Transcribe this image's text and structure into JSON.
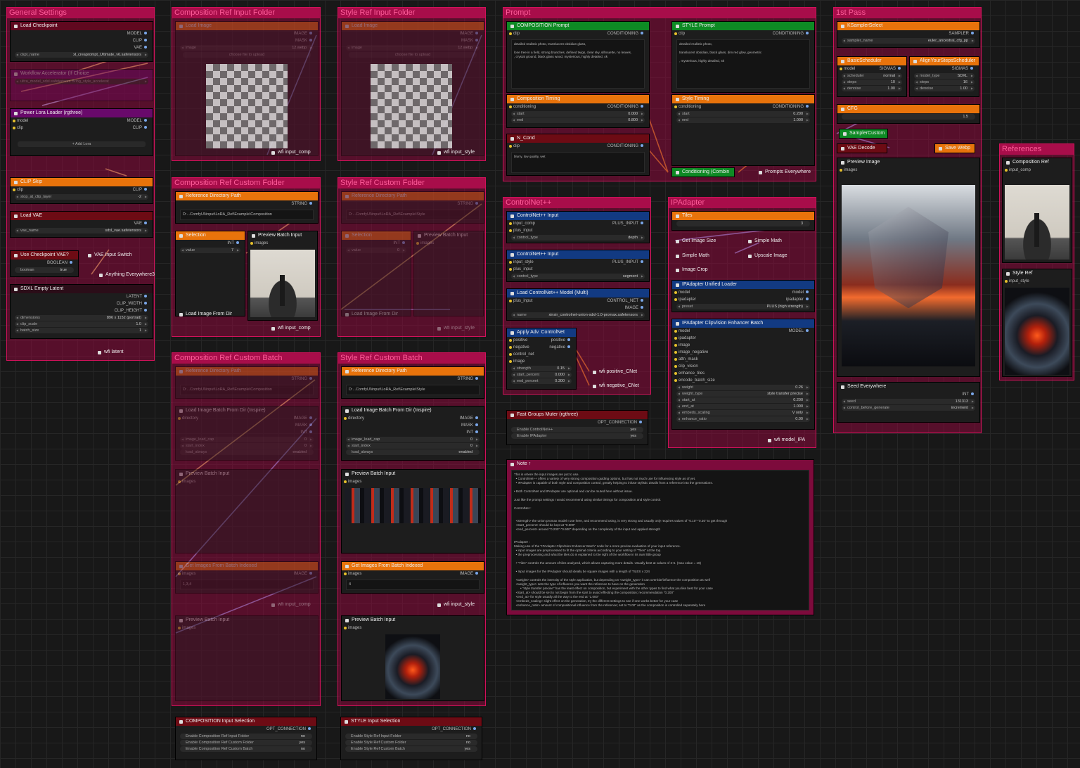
{
  "groups": {
    "general": "General Settings",
    "comp_ref_input": "Composition Ref Input Folder",
    "style_ref_input": "Style Ref Input Folder",
    "prompt": "Prompt",
    "first_pass": "1st Pass",
    "references": "References",
    "comp_custom_folder": "Composition Ref Custom Folder",
    "style_custom_folder": "Style Ref Custom Folder",
    "controlnet": "ControlNet++",
    "ipadapter": "IPAdapter",
    "comp_custom_batch": "Composition Ref Custom Batch",
    "style_custom_batch": "Style Ref Custom Batch"
  },
  "general": {
    "load_checkpoint": "Load Checkpoint",
    "out_model": "MODEL",
    "out_clip": "CLIP",
    "out_vae": "VAE",
    "ckpt_label": "ckpt_name",
    "ckpt_value": "xl_creaprompt_Ultimate_v6.safetensors",
    "dim_node": "Workflow Accelerator (If Choice",
    "dim_row1": "ultra_model_sdxl.safetensors  Bring_style_accelerat",
    "dim_row2": "",
    "lora_title": "Power Lora Loader (rgthree)",
    "lora_in_model": "model",
    "lora_in_clip": "clip",
    "add_lora": "+ Add Lora",
    "clip_skip": "CLIP Skip",
    "clip_in": "clip",
    "clip_out": "CLIP",
    "stop_label": "stop_at_clip_layer",
    "stop_value": "-2",
    "load_vae": "Load VAE",
    "vae_out": "VAE",
    "vae_label": "vae_name",
    "vae_value": "sdxl_vae.safetensors",
    "use_ckpt_vae": "Use Checkpoint VAE?",
    "boolean_out": "BOOLEAN",
    "boolean_label": "boolean",
    "boolean_value": "true",
    "vae_switch": "VAE Input Switch",
    "anything": "Anything Everywhere3",
    "sdxl_latent": "SDXL Empty Latent",
    "latent_out": "LATENT",
    "clip_width": "CLIP_WIDTH",
    "clip_height": "CLIP_HEIGHT",
    "dim_label": "dimensions",
    "dim_value": "896 x 1152  (portrait)",
    "clip_scale_label": "clip_scale",
    "clip_scale_value": "1.0",
    "batch_label": "batch_size",
    "batch_value": "1",
    "wifi_latent": "wfi latent"
  },
  "comp_input": {
    "load_image": "Load Image",
    "image_out": "IMAGE",
    "mask_out": "MASK",
    "image_label": "image",
    "image_value": "12.webp",
    "choose": "choose file to upload",
    "wifi": "wfi input_comp"
  },
  "style_input": {
    "load_image": "Load Image",
    "image_out": "IMAGE",
    "mask_out": "MASK",
    "image_label": "image",
    "image_value": "12.webp",
    "choose": "choose file to upload",
    "wifi": "wfi input_style"
  },
  "prompt": {
    "comp_prompt": "COMPOSITION Prompt",
    "clip": "clip",
    "conditioning": "CONDITIONING",
    "comp_text": "detailed realistic photo, translucent obsidian glass,\n\nlone tree in a field, strong branches, defined twigs, clear sky, silhouette, no leaves,\n, crystal ground, black glass wood, mysterious, highly detailed, 4k",
    "style_prompt": "STYLE Prompt",
    "style_text": "detailed realistic photo,\n\ntranslucent obsidian, black glass, dim red glow, geometric\n\n, mysterious, highly detailed, 4k",
    "comp_timing": "Composition Timing",
    "style_timing": "Style Timing",
    "cond_in": "conditioning",
    "start": "start",
    "end": "end",
    "comp_start": "0.000",
    "comp_end": "0.800",
    "style_start": "0.200",
    "style_end": "1.000",
    "n_cond": "N_Cond",
    "n_text": "blurry, low quality, wet",
    "combine": "Conditioning (Combin",
    "prompts_everywhere": "Prompts Everywhere"
  },
  "first_pass": {
    "ksampler": "KSamplerSelect",
    "sampler_out": "SAMPLER",
    "sampler_label": "sampler_name",
    "sampler_value": "euler_ancestral_cfg_pp",
    "basic_sched": "BasicScheduler",
    "align_sched": "AlignYourStepsScheduler",
    "model": "model",
    "sigmas": "SIGMAS",
    "scheduler_label": "scheduler",
    "scheduler_value": "normal",
    "steps_label": "steps",
    "steps_value": "10",
    "denoise_label": "denoise",
    "denoise_value": "1.00",
    "model_type_label": "model_type",
    "model_type_value": "SDXL",
    "steps2_value": "16",
    "denoise2_value": "1.00",
    "cfg": "CFG",
    "cfg_value": "1.5",
    "sampler_custom": "SamplerCustom",
    "vae_decode": "VAE Decode",
    "save_webp": "Save Webp",
    "preview": "Preview Image",
    "images": "images",
    "seed_everywhere": "Seed Everywhere",
    "int_out": "INT",
    "seed_label": "seed",
    "seed_value": "131313",
    "control_label": "control_before_generate",
    "control_value": "increment"
  },
  "references": {
    "comp_ref": "Composition Ref",
    "comp_in": "input_comp",
    "style_ref": "Style Ref",
    "style_in": "input_style"
  },
  "comp_folder": {
    "ref_dir": "Reference Directory Path",
    "string_out": "STRING",
    "path": "D:...ComfyUI\\input\\LoRA_Ref\\Example\\Composition",
    "selection": "Selection",
    "int_out": "INT",
    "value_label": "value",
    "value": "7",
    "preview_batch": "Preview Batch Input",
    "images": "images",
    "load_from_dir": "Load Image From Dir",
    "wifi": "wfi input_comp"
  },
  "style_folder": {
    "ref_dir": "Reference Directory Path",
    "string_out": "STRING",
    "path": "D:...ComfyUI\\input\\LoRA_Ref\\Example\\Style",
    "selection": "Selection",
    "int_out": "INT",
    "value_label": "value",
    "value": "0",
    "preview_batch": "Preview Batch Input",
    "images": "images",
    "load_from_dir": "Load Image From Dir",
    "wifi": "wfi input_style"
  },
  "controlnet": {
    "cn_input1": "ControlNet++ Input",
    "input_comp": "input_comp",
    "plus_input": "plus_input",
    "plus_out": "PLUS_INPUT",
    "control_type": "control_type",
    "type1": "depth",
    "cn_input2": "ControlNet++ Input",
    "input_style": "input_style",
    "type2": "segment",
    "load_multi": "Load ControlNet++ Model (Multi)",
    "control_net_out": "CONTROL_NET",
    "image_out": "IMAGE",
    "name_label": "name",
    "name_value": "xinsir_controlnet-union-sdxl-1.0-promax.safetensors",
    "apply": "Apply Adv. ControlNet",
    "positive": "positive",
    "negative": "negative",
    "control_net": "control_net",
    "image": "image",
    "strength_label": "strength",
    "strength_value": "0.15",
    "start_label": "start_percent",
    "start_value": "0.000",
    "end_label": "end_percent",
    "end_value": "0.300",
    "wifi_pos": "wfi positive_CNet",
    "wifi_neg": "wfi negative_CNet"
  },
  "muter": {
    "title": "Fast Groups Muter (rgthree)",
    "out": "OPT_CONNECTION",
    "cn_label": "Enable ControlNet++",
    "cn_value": "yes",
    "ipa_label": "Enable IPAdapter",
    "ipa_value": "yes"
  },
  "ipadapter": {
    "tiles": "Tiles",
    "tiles_value": "3",
    "get_size": "Get Image Size",
    "simple_math1": "Simple Math",
    "simple_math2": "Simple Math",
    "upscale": "Upscale Image",
    "crop": "Image Crop",
    "unified_loader": "IPAdapter Unified Loader",
    "model": "model",
    "ipadapter": "ipadapter",
    "preset_label": "preset",
    "preset_value": "PLUS (high strength)",
    "enhancer": "IPAdapter ClipVision Enhancer Batch",
    "model_out": "MODEL",
    "image": "image",
    "image_negative": "image_negative",
    "attn_mask": "attn_mask",
    "clip_vision": "clip_vision",
    "enhance_tiles": "enhance_tiles",
    "encode_batch": "encode_batch_size",
    "weight_label": "weight",
    "weight_value": "0.26",
    "weight_type_label": "weight_type",
    "weight_type_value": "style transfer precise",
    "start_label": "start_at",
    "start_value": "0.200",
    "end_label": "end_at",
    "end_value": "1.000",
    "embeds_label": "embeds_scaling",
    "embeds_value": "V only",
    "ratio_label": "enhance_ratio",
    "ratio_value": "0.00",
    "wifi": "wfi model_IPA"
  },
  "note": {
    "title": "Note ↑",
    "text": "This is where the input images are put to use.\n  • ControlNet++ offers a variety of very strong composition guiding options, but has not much use for influencing style as of yet.\n  • IPAdapter is capable of both style and composition control, greatly helping to infuse stylistic details from a reference into the generations.\n\n• Both ControlNet and IPAdapter are optional and can be muted here without issue.\n\nJust like the prompt settings I would recommend using similar timings for composition and style control.\n\nControlNet :\n\n\n  <strength> the union promax model I use here, and recommend using, is very strong and usually only requires values of \"0.10\"-\"0.30\" to get through\n  <start_percent> should be kept at \"0.000\"\n  <end_percent> around \"0.200\"-\"0.600\" depending on the complexity of the input and applied strength\n\n\nIPAdapter :\nMaking use of the \"IPAdapter ClipVision Enhancer Batch\" node for a more precise evaluation of your input reference.\n  • input images are preprocessed to fit the optimal criteria according to your setting of \"Tiles\" at the top.\n  • the preprocessing and what the tiles do is explained to the right of the workflow in its own little group\n\n  • \"Tiles\" controls the amount of tiles analyzed, which allows capturing more details. Usually best at values of 2-5. (max value = 16)\n\n  • Input images for the IPAdapter should ideally be square images with a length of TILES x 224\n\n  <weight> controls the intensity of the style application, but depending on <weight_type> it can override/influence the composition as well\n  <weight_type> sets the type of influence you want the reference to have on the generation\n       • \"style transfer precise\" has the least effect on composition, but experiment with the other types to find what you like best for your case\n  <start_at> should be set to not begin from the start to avoid effecting the composition; recommendation \"0.200\"\n  <end_at> for style usually all the way to the end at \"1.000\"\n  <embeds_scaling> slight effect on the generation, try the different settings to see if one works better for your case\n  <enhance_ratio> amount of compositional influence from the reference; set to \"0.00\" as the composition is controlled separately here"
  },
  "comp_batch": {
    "ref_dir": "Reference Directory Path",
    "string_out": "STRING",
    "path": "D:...ComfyUI\\input\\LoRA_Ref\\Example\\Composition",
    "load_batch": "Load Image Batch From Dir (Inspire)",
    "directory": "directory",
    "image_out": "IMAGE",
    "mask_out": "MASK",
    "int_out": "INT",
    "load_cap_label": "image_load_cap",
    "load_cap_value": "0",
    "start_index_label": "start_index",
    "start_index_value": "0",
    "load_always_label": "load_always",
    "load_always_value": "enabled",
    "preview_batch": "Preview Batch Input",
    "images": "images",
    "get_indexed": "Get Images From Batch Indexed",
    "indexed_images": "images",
    "indexed_value": "1,3,4",
    "wifi": "wfi input_comp",
    "preview_batch2": "Preview Batch Input"
  },
  "style_batch": {
    "ref_dir": "Reference Directory Path",
    "string_out": "STRING",
    "path": "D:...ComfyUI\\input\\LoRA_Ref\\Example\\Style",
    "load_batch": "Load Image Batch From Dir (Inspire)",
    "directory": "directory",
    "image_out": "IMAGE",
    "mask_out": "MASK",
    "int_out": "INT",
    "load_cap_label": "image_load_cap",
    "load_cap_value": "0",
    "start_index_label": "start_index",
    "start_index_value": "0",
    "load_always_label": "load_always",
    "load_always_value": "enabled",
    "preview_batch": "Preview Batch Input",
    "images": "images",
    "get_indexed": "Get Images From Batch Indexed",
    "indexed_images": "images",
    "indexed_value": "4",
    "wifi": "wfi input_style",
    "preview_batch2": "Preview Batch Input"
  },
  "comp_selection": {
    "title": "COMPOSITION Input Selection",
    "out": "OPT_CONNECTION",
    "opt1": "Enable Composition Ref Input Folder",
    "opt1_value": "no",
    "opt2": "Enable Composition Ref Custom Folder",
    "opt2_value": "yes",
    "opt3": "Enable Composition Ref Custom Batch",
    "opt3_value": "no"
  },
  "style_selection": {
    "title": "STYLE Input Selection",
    "out": "OPT_CONNECTION",
    "opt1": "Enable Style Ref Input Folder",
    "opt1_value": "no",
    "opt2": "Enable Style Ref Custom Folder",
    "opt2_value": "no",
    "opt3": "Enable Style Ref Custom Batch",
    "opt3_value": "yes"
  },
  "colors": {
    "group": "#d0125a",
    "orange": "#e8730b",
    "green": "#0e8a24",
    "blue": "#123a82",
    "purple": "#69096b"
  }
}
